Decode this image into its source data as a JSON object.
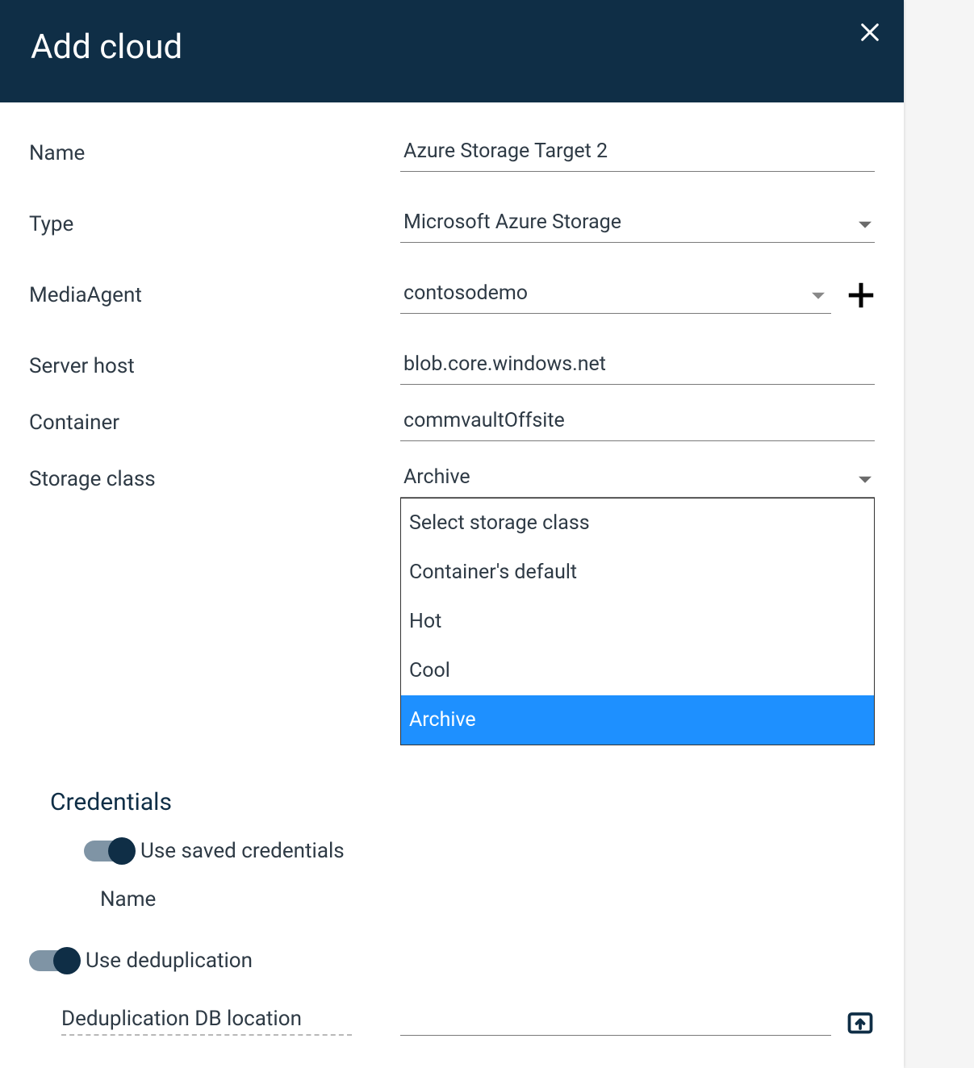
{
  "header": {
    "title": "Add cloud"
  },
  "form": {
    "name_label": "Name",
    "name_value": "Azure Storage Target 2",
    "type_label": "Type",
    "type_value": "Microsoft Azure Storage",
    "media_label": "MediaAgent",
    "media_value": "contosodemo",
    "server_label": "Server host",
    "server_value": "blob.core.windows.net",
    "container_label": "Container",
    "container_value": "commvaultOffsite",
    "storage_label": "Storage class",
    "storage_value": "Archive",
    "storage_options": [
      {
        "label": "Select storage class",
        "selected": false
      },
      {
        "label": "Container's default",
        "selected": false
      },
      {
        "label": "Hot",
        "selected": false
      },
      {
        "label": "Cool",
        "selected": false
      },
      {
        "label": "Archive",
        "selected": true
      }
    ]
  },
  "credentials": {
    "section_title": "Credentials",
    "use_saved_label": "Use saved credentials",
    "name_label": "Name"
  },
  "dedup": {
    "use_dedup_label": "Use deduplication",
    "db_location_label": "Deduplication DB location"
  }
}
